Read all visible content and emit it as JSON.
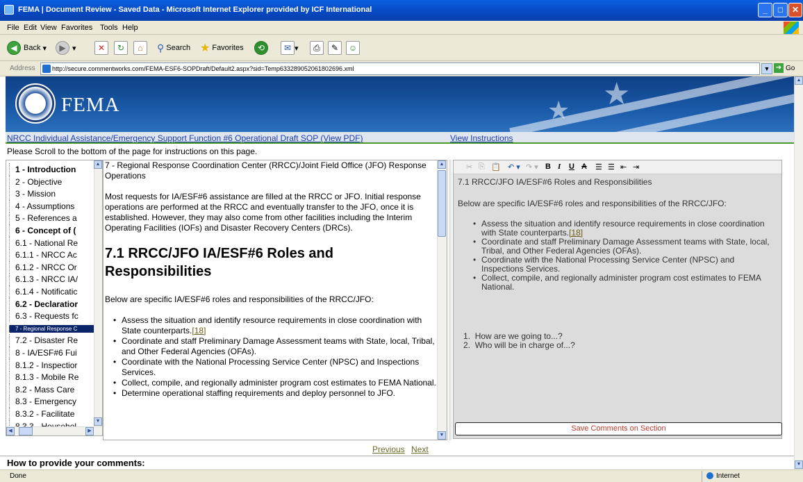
{
  "window": {
    "title": "FEMA | Document Review - Saved Data - Microsoft Internet Explorer provided by ICF International"
  },
  "menu": [
    "File",
    "Edit",
    "View",
    "Favorites",
    "Tools",
    "Help"
  ],
  "toolbar": {
    "back": "Back",
    "search": "Search",
    "favorites": "Favorites"
  },
  "address": {
    "label": "Address",
    "url": "http://secure.commentworks.com/FEMA-ESF6-SOPDraft/Default2.aspx?sid=Temp633289052061802696.xml",
    "go": "Go"
  },
  "banner": {
    "brand": "FEMA"
  },
  "nav": {
    "link1": "NRCC Individual Assistance/Emergency Support Function #6 Operational Draft SOP (View PDF)",
    "link2": "View Instructions"
  },
  "scroll_note": "Please Scroll to the bottom of the page for instructions on this page.",
  "tree": [
    {
      "label": "1 - Introduction",
      "bold": true
    },
    {
      "label": "2 - Objective",
      "bold": false
    },
    {
      "label": "3 - Mission",
      "bold": false
    },
    {
      "label": "4 - Assumptions",
      "bold": false
    },
    {
      "label": "5 - References a",
      "bold": false
    },
    {
      "label": "6 - Concept of (",
      "bold": true
    },
    {
      "label": "6.1 - National Re",
      "bold": false
    },
    {
      "label": "6.1.1 - NRCC Ac",
      "bold": false
    },
    {
      "label": "6.1.2 - NRCC Or",
      "bold": false
    },
    {
      "label": "6.1.3 - NRCC IA/",
      "bold": false
    },
    {
      "label": "6.1.4 - Notificatic",
      "bold": false
    },
    {
      "label": "6.2 - Declaratior",
      "bold": true
    },
    {
      "label": "6.3 - Requests fc",
      "bold": false
    },
    {
      "label": "7 - Regional Response C",
      "bold": false,
      "selected": true
    },
    {
      "label": "7.2 - Disaster Re",
      "bold": false
    },
    {
      "label": "8 - IA/ESF#6 Fui",
      "bold": false
    },
    {
      "label": "8.1.2 - Inspectior",
      "bold": false
    },
    {
      "label": "8.1.3 - Mobile Re",
      "bold": false
    },
    {
      "label": "8.2 - Mass Care",
      "bold": false
    },
    {
      "label": "8.3 - Emergency",
      "bold": false
    },
    {
      "label": "8.3.2 - Facilitate",
      "bold": false
    },
    {
      "label": "8.3.3 - Househol",
      "bold": false
    }
  ],
  "doc": {
    "heading_line": "7 - Regional Response Coordination Center (RRCC)/Joint Field Office (JFO) Response Operations",
    "intro": "Most requests for IA/ESF#6 assistance are filled at the RRCC or JFO. Initial response operations are performed at the RRCC and eventually transfer to the JFO, once it is established. However, they may also come from other facilities including the Interim Operating Facilities (IOFs) and Disaster Recovery Centers (DRCs).",
    "section_title": "7.1 RRCC/JFO IA/ESF#6 Roles and Responsibilities",
    "below": "Below are specific IA/ESF#6 roles and responsibilities of the RRCC/JFO:",
    "bullets": [
      "Assess the situation and identify resource requirements in close coordination with State counterparts.",
      "Coordinate and staff Preliminary Damage Assessment teams with State, local, Tribal, and Other Federal Agencies (OFAs).",
      "Coordinate with the National Processing Service Center (NPSC) and Inspections Services.",
      "Collect, compile, and regionally administer program cost estimates to FEMA National.",
      "Determine operational staffing requirements and deploy personnel to JFO."
    ],
    "footnote": "[18]"
  },
  "editor": {
    "title": "7.1 RRCC/JFO IA/ESF#6 Roles and Responsibilities",
    "below": "Below are specific IA/ESF#6 roles and responsibilities of the RRCC/JFO:",
    "bullets": [
      "Assess the situation and identify resource requirements in close coordination with State counterparts.",
      "Coordinate and staff Preliminary Damage Assessment teams with State, local, Tribal, and Other Federal Agencies (OFAs).",
      "Coordinate with the National Processing Service Center (NPSC) and Inspections Services.",
      "Collect, compile, and regionally administer program cost estimates to FEMA National."
    ],
    "footnote": "[18]",
    "numbered": [
      "How are we going to...?",
      "Who will be in charge of...?"
    ],
    "save_label": "Save Comments on Section"
  },
  "pager": {
    "previous": "Previous",
    "next": "Next"
  },
  "howto": "How to provide your comments:",
  "status": {
    "left": "Done",
    "zone": "Internet"
  }
}
